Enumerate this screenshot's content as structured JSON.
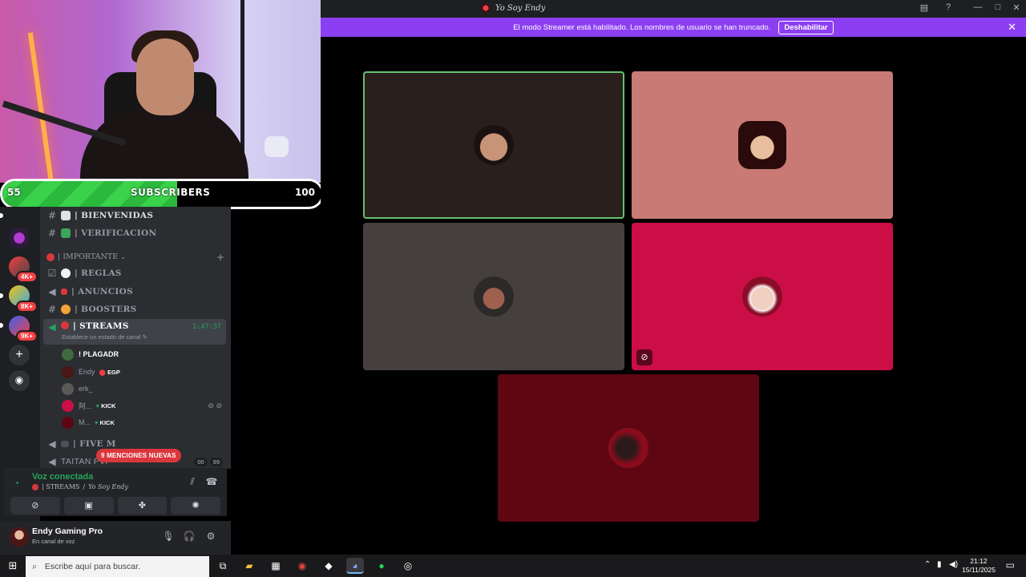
{
  "window": {
    "title": "Yo Soy Endy"
  },
  "banner": {
    "text": "El modo Streamer está habilitado. Los nombres de usuario se han truncado.",
    "button": "Deshabilitar"
  },
  "subscribers": {
    "current": "55",
    "label": "SUBSCRIBERS",
    "goal": "100",
    "progress": 0.55
  },
  "servers": {
    "badges": [
      "4K+",
      "8K+",
      "9K+"
    ]
  },
  "channels": {
    "items": [
      {
        "name": "| BIENVENIDAS",
        "icon": "#"
      },
      {
        "name": "| VERIFICACION",
        "icon": "#"
      }
    ],
    "category": "| IMPORTANTE",
    "important": [
      {
        "name": "| REGLAS",
        "icon": "☑"
      },
      {
        "name": "| ANUNCIOS",
        "icon": "📢"
      },
      {
        "name": "| BOOSTERS",
        "icon": "#"
      }
    ],
    "active": {
      "name": "| STREAMS",
      "timer": "1:47:37",
      "status": "Establece un estado de canal ✎"
    },
    "users": [
      {
        "name": "! PLAGADR",
        "tag": ""
      },
      {
        "name": "Endy",
        "tag": "EGP"
      },
      {
        "name": "erk_",
        "tag": ""
      },
      {
        "name": "阿...",
        "tag": "KICK"
      },
      {
        "name": "M...",
        "tag": "KICK"
      }
    ],
    "voice2": {
      "name": "| FIVE M"
    },
    "voice3": {
      "name": "TAITAN PVP",
      "counts": [
        "00",
        "99"
      ]
    },
    "mentions": "9 MENCIONES NUEVAS"
  },
  "voice": {
    "title": "Voz conectada",
    "channel": "| STREAMS",
    "server": "Yo Soy Endy"
  },
  "user": {
    "name": "Endy Gaming Pro",
    "status": "En canal de voz"
  },
  "taskbar": {
    "search_placeholder": "Escribe aquí para buscar.",
    "time": "21:12",
    "date": "15/11/2025"
  },
  "colors": {
    "banner": "#8c3ff2",
    "speaking": "#65c16f",
    "tiles": [
      "#2a1f1c",
      "#c97a74",
      "#45403d",
      "#cc0e47",
      "#5e0713"
    ]
  }
}
